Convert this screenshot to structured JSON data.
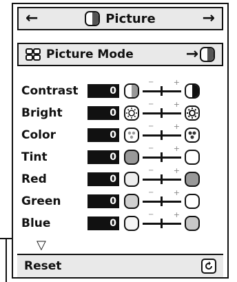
{
  "header": {
    "title": "Picture",
    "left_arrow_icon": "arrow-left-icon",
    "right_arrow_icon": "arrow-right-icon"
  },
  "mode": {
    "label": "Picture Mode"
  },
  "rows": [
    {
      "label": "Contrast",
      "value": "0",
      "icon_left": "contrast-icon-low",
      "icon_right": "contrast-icon-high",
      "minus": "−",
      "plus": "+"
    },
    {
      "label": "Bright",
      "value": "0",
      "icon_left": "sun-icon-low",
      "icon_right": "sun-icon-high",
      "minus": "−",
      "plus": "+"
    },
    {
      "label": "Color",
      "value": "0",
      "icon_left": "color-dots-icon",
      "icon_right": "color-dots-icon",
      "minus": "−",
      "plus": "+"
    },
    {
      "label": "Tint",
      "value": "0",
      "icon_left": "tint-dark-icon",
      "icon_right": "tint-light-icon",
      "minus": "−",
      "plus": "+"
    },
    {
      "label": "Red",
      "value": "0",
      "icon_left": "circle-light-icon",
      "icon_right": "circle-dark-icon",
      "minus": "−",
      "plus": "+"
    },
    {
      "label": "Green",
      "value": "0",
      "icon_left": "circle-medium-icon",
      "icon_right": "circle-light-icon",
      "minus": "−",
      "plus": "+"
    },
    {
      "label": "Blue",
      "value": "0",
      "icon_left": "circle-light-icon",
      "icon_right": "circle-medium-icon",
      "minus": "−",
      "plus": "+"
    }
  ],
  "footer": {
    "more_indicator": "▽",
    "reset_label": "Reset"
  }
}
